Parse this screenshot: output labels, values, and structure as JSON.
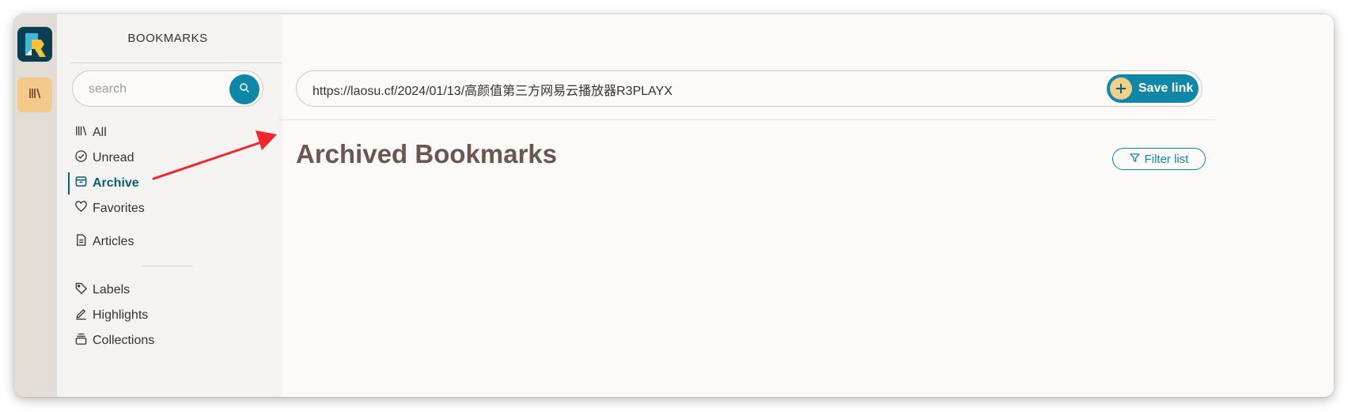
{
  "colors": {
    "accent": "#0f87a7",
    "accent_dark": "#0b5e7a",
    "title": "#6d5550",
    "rail_bg": "#e2ddd7",
    "rail_button_bg": "#f3c98e",
    "annotation_arrow": "#f0262c"
  },
  "rail": {
    "logo_icon": "readeck-logo-icon",
    "bookmarks_icon": "library-icon"
  },
  "sidebar": {
    "title": "BOOKMARKS",
    "search": {
      "placeholder": "search",
      "value": ""
    },
    "nav": [
      {
        "label": "All",
        "icon": "library-icon",
        "active": false
      },
      {
        "label": "Unread",
        "icon": "check-circle-icon",
        "active": false
      },
      {
        "label": "Archive",
        "icon": "archive-icon",
        "active": true
      },
      {
        "label": "Favorites",
        "icon": "heart-icon",
        "active": false
      },
      {
        "label": "Articles",
        "icon": "document-icon",
        "active": false
      },
      {
        "label": "Labels",
        "icon": "tag-icon",
        "active": false
      },
      {
        "label": "Highlights",
        "icon": "highlighter-icon",
        "active": false
      },
      {
        "label": "Collections",
        "icon": "collections-icon",
        "active": false
      }
    ]
  },
  "main": {
    "url_input": {
      "value": "https://laosu.cf/2024/01/13/高颜值第三方网易云播放器R3PLAYX"
    },
    "save_label": "Save link",
    "page_title": "Archived Bookmarks",
    "filter_label": "Filter list"
  }
}
